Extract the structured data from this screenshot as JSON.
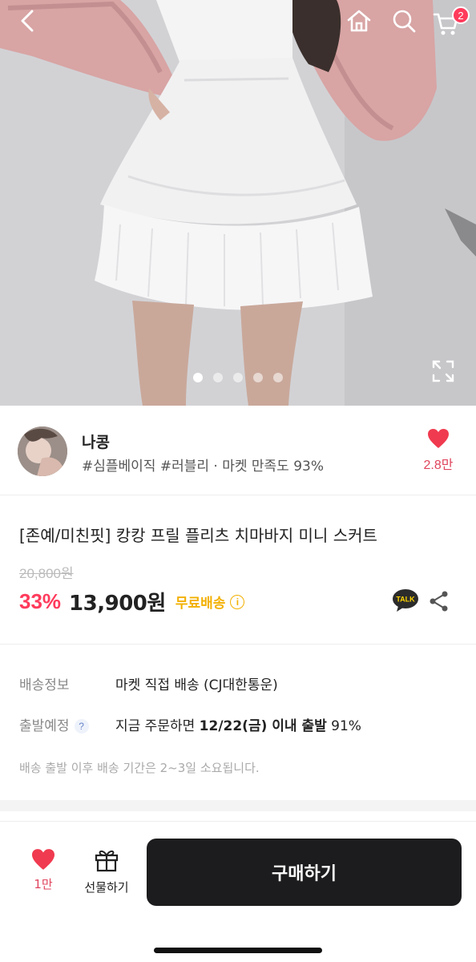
{
  "hero": {
    "cart_count": "2",
    "carousel": {
      "total_images": 5,
      "active_index": 0
    },
    "icons": [
      "back-icon",
      "home-icon",
      "search-icon",
      "cart-icon",
      "expand-icon"
    ]
  },
  "seller": {
    "name": "나콩",
    "tags": "#심플베이직 #러블리 · 마켓 만족도 93%",
    "like_count": "2.8만"
  },
  "product": {
    "title": "[존예/미친핏] 캉캉 프릴 플리츠 치마바지 미니 스커트",
    "original_price": "20,800원",
    "discount": "33%",
    "price": "13,900원",
    "free_shipping": "무료배송",
    "info_symbol": "i",
    "talk_label": "TALK"
  },
  "delivery": {
    "shipping_label": "배송정보",
    "shipping_value": "마켓 직접 배송 (CJ대한통운)",
    "departure_label": "출발예정",
    "departure_help": "?",
    "departure_prefix": "지금 주문하면 ",
    "departure_date": "12/22(금) 이내 출발",
    "departure_rate": " 91%",
    "note": "배송 출발 이후 배송 기간은 2~3일 소요됩니다."
  },
  "bottom_bar": {
    "like_count": "1만",
    "gift_label": "선물하기",
    "buy_label": "구매하기"
  },
  "colors": {
    "accent_pink": "#ff3b5c",
    "heart_red": "#f03a4f",
    "free_ship_yellow": "#f2b000",
    "buy_button": "#1c1c1e"
  }
}
